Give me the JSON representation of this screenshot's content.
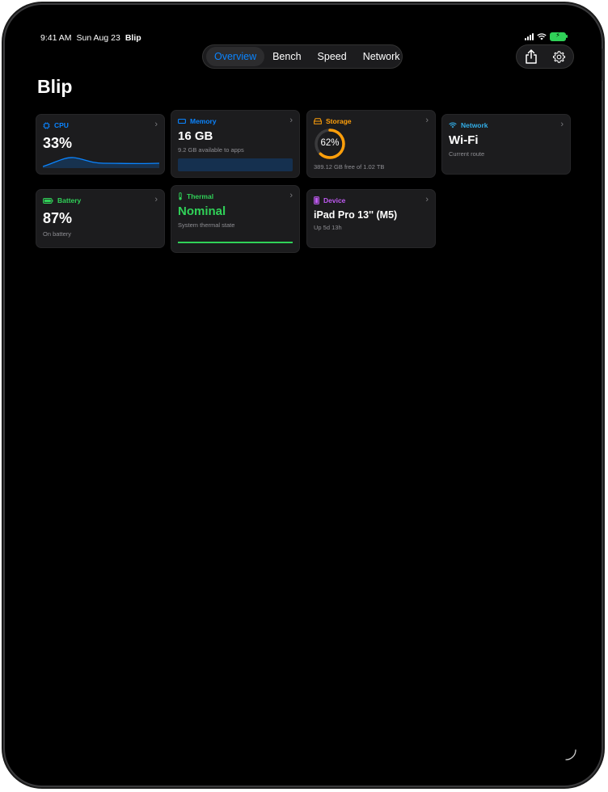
{
  "status": {
    "time": "9:41 AM",
    "date": "Sun Aug 23",
    "app": "Blip",
    "battery": "⚡"
  },
  "tabs": [
    {
      "label": "Overview"
    },
    {
      "label": "Bench"
    },
    {
      "label": "Speed"
    },
    {
      "label": "Network"
    }
  ],
  "actions": {
    "share_icon": "share-icon",
    "settings_icon": "gear-icon"
  },
  "page_title": "Blip",
  "colors": {
    "accent": "#0a84ff",
    "storage": "#ff9f0a",
    "network": "#32ade6",
    "battery": "#30d158",
    "thermal": "#30d158",
    "device": "#bf5af2"
  },
  "cards": {
    "cpu": {
      "label": "CPU",
      "value": "33%",
      "icon": "cpu-icon"
    },
    "memory": {
      "label": "Memory",
      "value": "16 GB",
      "sub": "9.2 GB available to apps",
      "icon": "memory-icon"
    },
    "storage": {
      "label": "Storage",
      "percent": "62%",
      "percent_value": 62,
      "sub": "389.12 GB free of 1.02 TB",
      "icon": "drive-icon"
    },
    "network": {
      "label": "Network",
      "value": "Wi-Fi",
      "sub": "Current route",
      "icon": "wifi-icon"
    },
    "battery": {
      "label": "Battery",
      "value": "87%",
      "sub": "On battery",
      "icon": "battery-icon"
    },
    "thermal": {
      "label": "Thermal",
      "value": "Nominal",
      "sub": "System thermal state",
      "icon": "thermometer-icon"
    },
    "device": {
      "label": "Device",
      "value": "iPad Pro 13'' (M5)",
      "sub": "Up 5d 13h",
      "icon": "ipad-icon"
    }
  }
}
